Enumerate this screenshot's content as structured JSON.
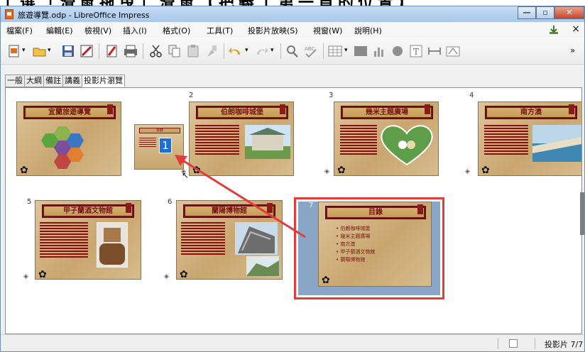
{
  "window": {
    "title": "旅遊導覽.odp - LibreOffice Impress"
  },
  "menubar": {
    "items": [
      "檔案(F)",
      "編輯(E)",
      "檢視(V)",
      "插入(I)",
      "格式(O)",
      "工具(T)",
      "投影片放映(S)",
      "視窗(W)",
      "說明(H)"
    ]
  },
  "view_tabs": [
    "一般",
    "大綱",
    "備註",
    "講義",
    "投影片瀏覽"
  ],
  "active_tab": "投影片瀏覽",
  "slides": [
    {
      "number": "",
      "title": "宜蘭旅遊導覽"
    },
    {
      "number": "2",
      "title": "伯朗咖啡城堡"
    },
    {
      "number": "3",
      "title": "幾米主題廣場"
    },
    {
      "number": "4",
      "title": "南方澳"
    },
    {
      "number": "5",
      "title": "甲子蘭酒文物館"
    },
    {
      "number": "6",
      "title": "蘭陽博物館"
    },
    {
      "number": "7",
      "title": "目錄"
    }
  ],
  "toc_slide": {
    "bullets": [
      "伯朗咖啡城堡",
      "幾米主題廣場",
      "南方澳",
      "甲子蘭酒文物館",
      "蘭陽博物館"
    ]
  },
  "drag_preview": {
    "title": "目錄",
    "number": "1"
  },
  "statusbar": {
    "slide_info": "投影片 7/7"
  },
  "colors": {
    "accent": "#e33a3a",
    "banner": "#7a1414",
    "slide_bg": "#c9a66f",
    "selection_bg": "#8aa6c6"
  }
}
